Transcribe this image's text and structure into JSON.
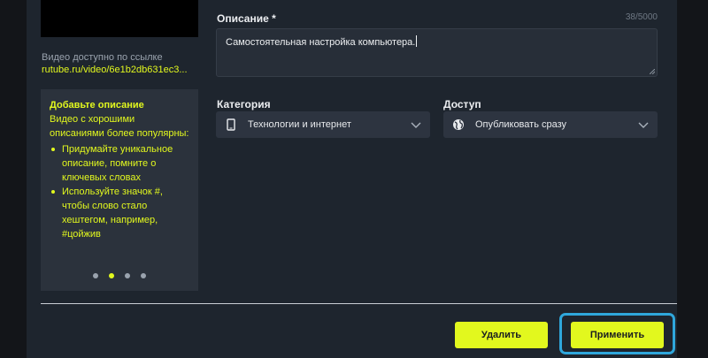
{
  "sidebar": {
    "availability_label": "Видео доступно по ссылке",
    "video_link": "rutube.ru/video/6e1b2db631ec3...",
    "tips": {
      "title": "Добавьте описание",
      "intro": "Видео с хорошими описаниями более популярны:",
      "items": [
        "Придумайте уникальное описание, помните о ключевых словах",
        "Используйте значок #, чтобы слово стало хештегом, например, #цойжив"
      ],
      "carousel_total": 4,
      "carousel_active_index": 1
    }
  },
  "form": {
    "description": {
      "label": "Описание *",
      "counter": "38/5000",
      "value": "Самостоятельная настройка компьютера."
    },
    "category": {
      "label": "Категория",
      "selected": "Технологии и интернет",
      "icon": "tablet-icon"
    },
    "access": {
      "label": "Доступ",
      "selected": "Опубликовать сразу",
      "icon": "globe-icon"
    }
  },
  "actions": {
    "delete_label": "Удалить",
    "apply_label": "Применить"
  },
  "colors": {
    "accent": "#e2f81e",
    "highlight": "#2fa7dc",
    "panel": "#1e252e",
    "background": "#131519"
  }
}
